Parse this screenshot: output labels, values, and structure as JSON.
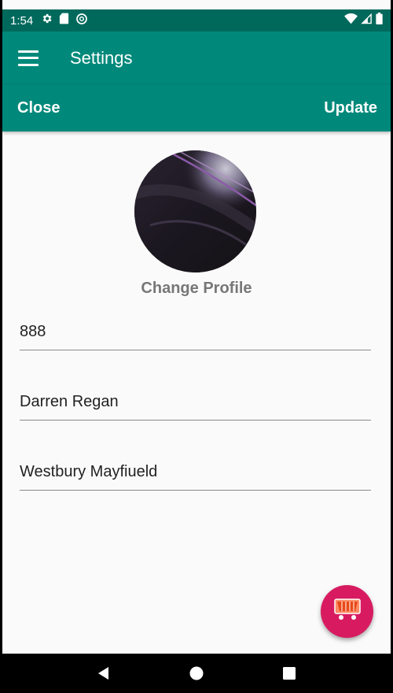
{
  "status_bar": {
    "time": "1:54",
    "left_icons": [
      "gear-icon",
      "sd-card-icon",
      "sync-icon"
    ],
    "right_icons": [
      "wifi-icon",
      "signal-icon",
      "battery-icon"
    ]
  },
  "app_bar": {
    "menu_icon": "menu-icon",
    "title": "Settings"
  },
  "action_bar": {
    "close_label": "Close",
    "update_label": "Update"
  },
  "profile": {
    "change_label": "Change Profile"
  },
  "fields": [
    {
      "value": "888"
    },
    {
      "value": "Darren Regan"
    },
    {
      "value": "Westbury Mayfiueld"
    }
  ],
  "fab": {
    "icon": "shopping-cart-icon"
  },
  "nav_bar": {
    "buttons": [
      "back-icon",
      "home-icon",
      "recents-icon"
    ]
  },
  "colors": {
    "primary": "#00897b",
    "primary_dark": "#00695c",
    "accent": "#d81b60"
  }
}
